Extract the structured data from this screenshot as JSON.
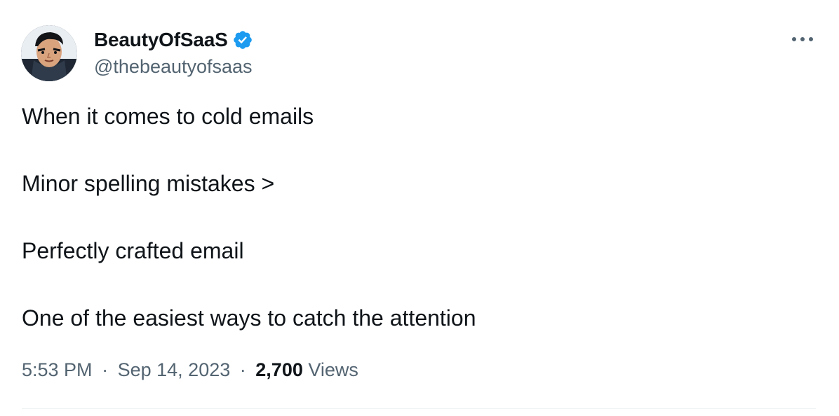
{
  "author": {
    "display_name": "BeautyOfSaaS",
    "handle": "@thebeautyofsaas",
    "verified": true
  },
  "icons": {
    "avatar": "avatar-icon",
    "verified": "verified-badge-icon",
    "more": "more-horizontal-icon"
  },
  "tweet": {
    "lines": [
      "When it comes to cold emails",
      "Minor spelling mistakes >",
      "Perfectly crafted email",
      "One of the easiest ways to catch the attention"
    ]
  },
  "meta": {
    "time": "5:53 PM",
    "separator": "·",
    "date": "Sep 14, 2023",
    "views_count": "2,700",
    "views_label": "Views"
  },
  "colors": {
    "text_primary": "#0f1419",
    "text_secondary": "#536471",
    "verified_blue": "#1d9bf0",
    "divider": "#eff3f4"
  }
}
